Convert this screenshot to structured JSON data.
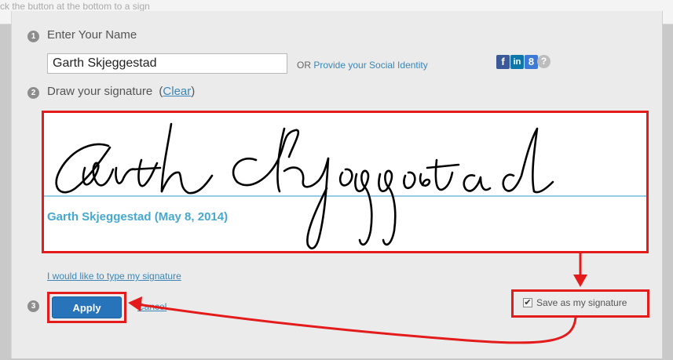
{
  "background_text": "ck the button at the bottom to a sign",
  "step1": {
    "number": "1",
    "label": "Enter Your Name",
    "name_value": "Garth Skjeggestad",
    "or_text": "OR",
    "social_link": "Provide your Social Identity",
    "social_icons": [
      {
        "name": "facebook-icon",
        "glyph": "f",
        "color": "#3b5998"
      },
      {
        "name": "linkedin-icon",
        "glyph": "in",
        "color": "#0e76a8"
      },
      {
        "name": "google-icon",
        "glyph": "8",
        "color": "#3d7ad6"
      }
    ],
    "help_glyph": "?"
  },
  "step2": {
    "number": "2",
    "label": "Draw your signature",
    "clear_paren_open": "(",
    "clear_link": "Clear",
    "clear_paren_close": ")",
    "signature_caption": "Garth Skjeggestad (May 8, 2014)",
    "type_link": "I would like to type my signature"
  },
  "step3": {
    "number": "3",
    "apply_label": "Apply",
    "cancel_label": "Cancel",
    "save_label": "Save as my signature",
    "save_checked": true
  },
  "colors": {
    "highlight_red": "#e31b1b",
    "link_blue": "#3b86b6",
    "apply_blue": "#2774ba",
    "signature_caption": "#47a8cf"
  }
}
